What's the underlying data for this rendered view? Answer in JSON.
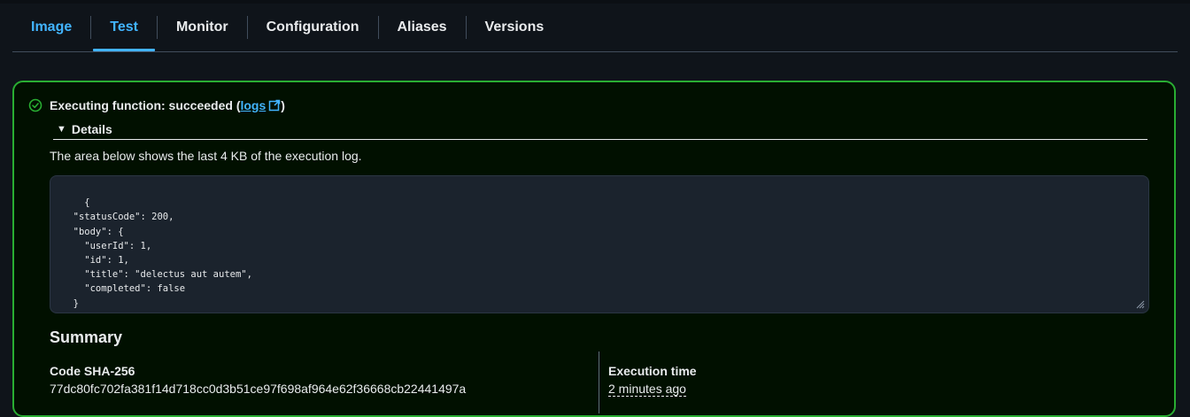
{
  "tabs": [
    {
      "label": "Image"
    },
    {
      "label": "Test"
    },
    {
      "label": "Monitor"
    },
    {
      "label": "Configuration"
    },
    {
      "label": "Aliases"
    },
    {
      "label": "Versions"
    }
  ],
  "result": {
    "status_prefix": "Executing function: succeeded (",
    "logs_link": "logs",
    "status_suffix": ")",
    "details_label": "Details",
    "description": "The area below shows the last 4 KB of the execution log.",
    "log_output": "{\n  \"statusCode\": 200,\n  \"body\": {\n    \"userId\": 1,\n    \"id\": 1,\n    \"title\": \"delectus aut autem\",\n    \"completed\": false\n  }\n}"
  },
  "summary": {
    "title": "Summary",
    "code_sha_label": "Code SHA-256",
    "code_sha_value": "77dc80fc702fa381f14d718cc0d3b51ce97f698af964e62f36668cb22441497a",
    "exec_time_label": "Execution time",
    "exec_time_value": "2 minutes ago"
  },
  "colors": {
    "accent": "#42b4ff",
    "success": "#29ad32",
    "background": "#0f141a"
  },
  "icons": {
    "status": "check-circle-icon",
    "external": "external-link-icon",
    "details": "caret-down-icon",
    "resize": "resize-handle-icon"
  }
}
